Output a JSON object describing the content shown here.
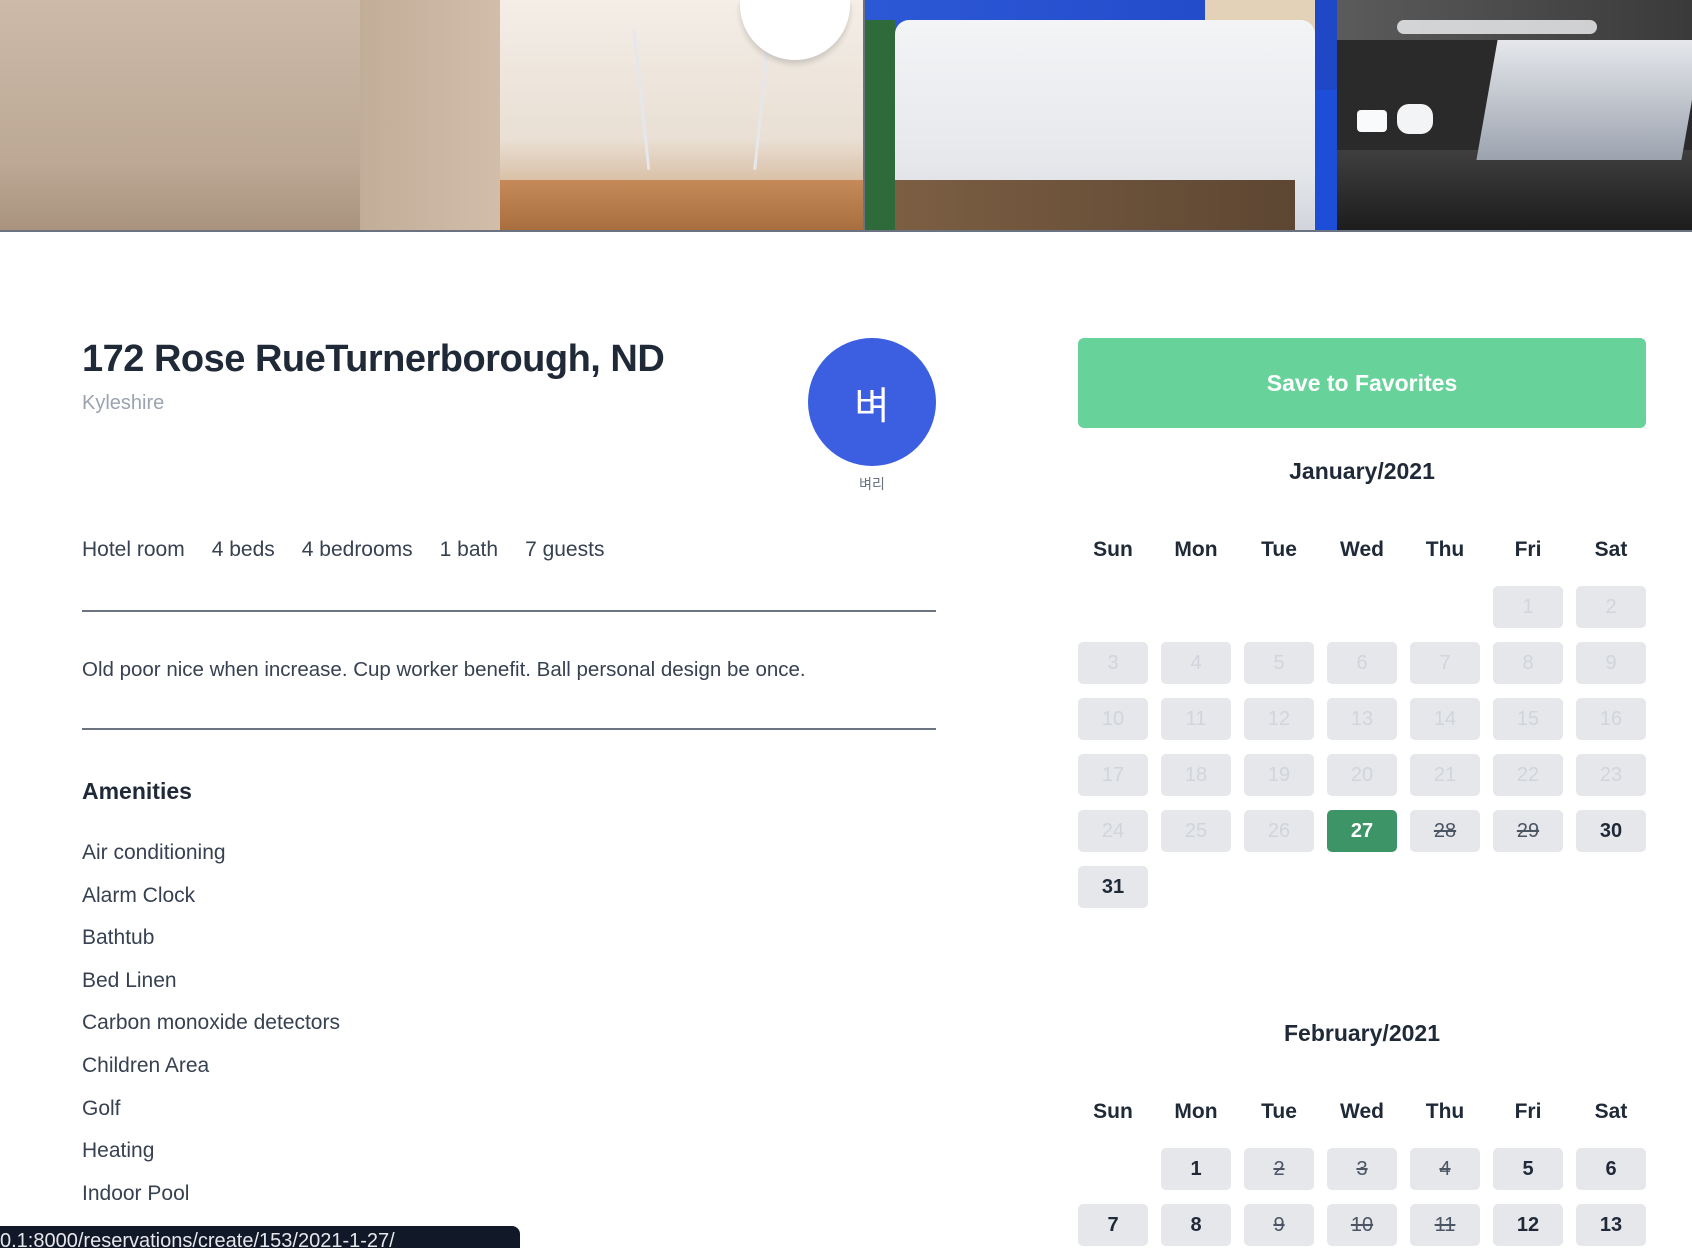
{
  "listing": {
    "title": "172 Rose RueTurnerborough, ND",
    "city": "Kyleshire",
    "host": {
      "avatar_letter": "벼",
      "name": "벼리"
    },
    "specs": [
      "Hotel room",
      "4 beds",
      "4 bedrooms",
      "1 bath",
      "7 guests"
    ],
    "description": "Old poor nice when increase. Cup worker benefit. Ball personal design be once.",
    "amenities_heading": "Amenities",
    "amenities": [
      "Air conditioning",
      "Alarm Clock",
      "Bathtub",
      "Bed Linen",
      "Carbon monoxide detectors",
      "Children Area",
      "Golf",
      "Heating",
      "Indoor Pool"
    ]
  },
  "actions": {
    "save_favorites": "Save to Favorites"
  },
  "status_url": "0.1:8000/reservations/create/153/2021-1-27/",
  "weekdays": [
    "Sun",
    "Mon",
    "Tue",
    "Wed",
    "Thu",
    "Fri",
    "Sat"
  ],
  "calendars": [
    {
      "title": "January/2021",
      "offset": 5,
      "days": [
        {
          "n": "1",
          "state": "past"
        },
        {
          "n": "2",
          "state": "past"
        },
        {
          "n": "3",
          "state": "past"
        },
        {
          "n": "4",
          "state": "past"
        },
        {
          "n": "5",
          "state": "past"
        },
        {
          "n": "6",
          "state": "past"
        },
        {
          "n": "7",
          "state": "past"
        },
        {
          "n": "8",
          "state": "past"
        },
        {
          "n": "9",
          "state": "past"
        },
        {
          "n": "10",
          "state": "past"
        },
        {
          "n": "11",
          "state": "past"
        },
        {
          "n": "12",
          "state": "past"
        },
        {
          "n": "13",
          "state": "past"
        },
        {
          "n": "14",
          "state": "past"
        },
        {
          "n": "15",
          "state": "past"
        },
        {
          "n": "16",
          "state": "past"
        },
        {
          "n": "17",
          "state": "past"
        },
        {
          "n": "18",
          "state": "past"
        },
        {
          "n": "19",
          "state": "past"
        },
        {
          "n": "20",
          "state": "past"
        },
        {
          "n": "21",
          "state": "past"
        },
        {
          "n": "22",
          "state": "past"
        },
        {
          "n": "23",
          "state": "past"
        },
        {
          "n": "24",
          "state": "past"
        },
        {
          "n": "25",
          "state": "past"
        },
        {
          "n": "26",
          "state": "past"
        },
        {
          "n": "27",
          "state": "selected"
        },
        {
          "n": "28",
          "state": "booked"
        },
        {
          "n": "29",
          "state": "booked"
        },
        {
          "n": "30",
          "state": "available"
        },
        {
          "n": "31",
          "state": "available"
        }
      ]
    },
    {
      "title": "February/2021",
      "offset": 1,
      "days": [
        {
          "n": "1",
          "state": "available"
        },
        {
          "n": "2",
          "state": "booked"
        },
        {
          "n": "3",
          "state": "booked"
        },
        {
          "n": "4",
          "state": "booked"
        },
        {
          "n": "5",
          "state": "available"
        },
        {
          "n": "6",
          "state": "available"
        },
        {
          "n": "7",
          "state": "available"
        },
        {
          "n": "8",
          "state": "available"
        },
        {
          "n": "9",
          "state": "booked"
        },
        {
          "n": "10",
          "state": "booked"
        },
        {
          "n": "11",
          "state": "booked"
        },
        {
          "n": "12",
          "state": "available"
        },
        {
          "n": "13",
          "state": "available"
        }
      ]
    }
  ],
  "colors": {
    "accent": "#68d29b",
    "selected": "#3d9466",
    "avatar": "#3b5fe0"
  }
}
